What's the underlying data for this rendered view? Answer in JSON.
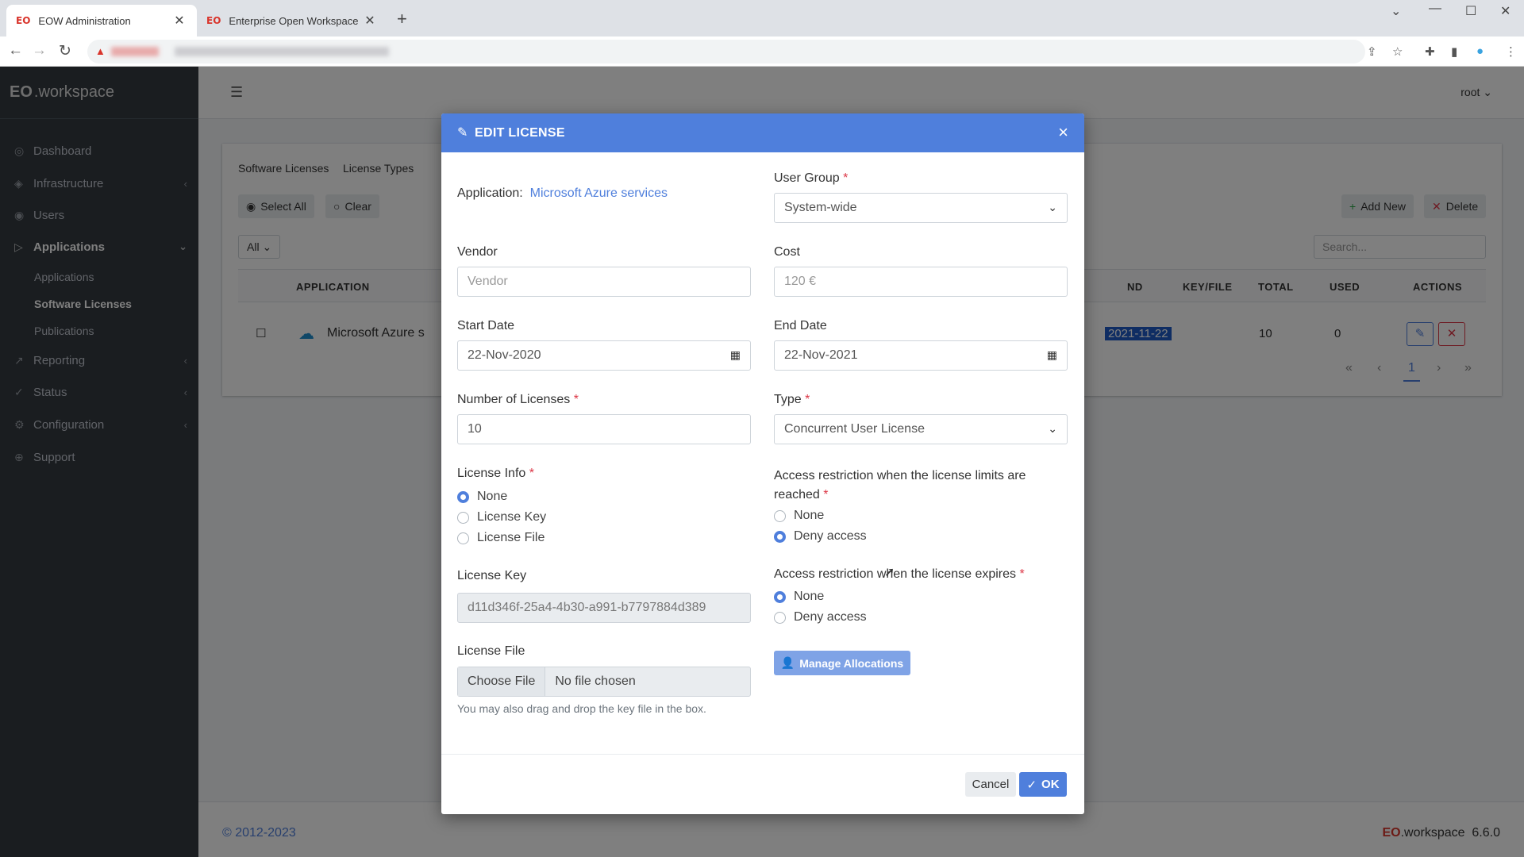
{
  "browser": {
    "tabs": [
      {
        "favicon": "EO",
        "title": "EOW Administration"
      },
      {
        "favicon": "EO",
        "title": "Enterprise Open Workspace"
      }
    ]
  },
  "app": {
    "brand_eo": "EO",
    "brand_name": ".workspace",
    "sidebar": {
      "items": [
        {
          "label": "Dashboard"
        },
        {
          "label": "Infrastructure"
        },
        {
          "label": "Users"
        },
        {
          "label": "Applications"
        },
        {
          "label": "Reporting"
        },
        {
          "label": "Status"
        },
        {
          "label": "Configuration"
        },
        {
          "label": "Support"
        }
      ],
      "subitems": [
        "Applications",
        "Software Licenses",
        "Publications"
      ]
    },
    "user": "root",
    "card": {
      "tabs": [
        "Software Licenses",
        "License Types"
      ],
      "select_all": "Select All",
      "clear": "Clear",
      "filter": "All",
      "add_new": "Add New",
      "delete": "Delete",
      "search_placeholder": "Search...",
      "columns": [
        "APPLICATION",
        "ND",
        "KEY/FILE",
        "TOTAL",
        "USED",
        "ACTIONS"
      ],
      "row": {
        "application": "Microsoft Azure s",
        "end": "2021-11-22",
        "total": "10",
        "used": "0"
      },
      "page": "1"
    },
    "footer": {
      "copyright": "© 2012-2023",
      "brand_eo": "EO",
      "brand_name": ".workspace",
      "version": "6.6.0"
    }
  },
  "modal": {
    "title": "EDIT LICENSE",
    "application_label": "Application:",
    "application_value": "Microsoft Azure services",
    "user_group": {
      "label": "User Group",
      "value": "System-wide"
    },
    "vendor": {
      "label": "Vendor",
      "placeholder": "Vendor"
    },
    "cost": {
      "label": "Cost",
      "value": "120 €"
    },
    "start_date": {
      "label": "Start Date",
      "value": "22-Nov-2020"
    },
    "end_date": {
      "label": "End Date",
      "value": "22-Nov-2021"
    },
    "num_licenses": {
      "label": "Number of Licenses",
      "value": "10"
    },
    "type": {
      "label": "Type",
      "value": "Concurrent User License"
    },
    "license_info": {
      "label": "License Info",
      "options": [
        "None",
        "License Key",
        "License File"
      ],
      "selected": "None"
    },
    "restriction_limits": {
      "label_line1": "Access restriction when the license limits are",
      "label_line2": "reached",
      "options": [
        "None",
        "Deny access"
      ],
      "selected": "Deny access"
    },
    "restriction_expires": {
      "label": "Access restriction when the license expires",
      "options": [
        "None",
        "Deny access"
      ],
      "selected": "None"
    },
    "license_key": {
      "label": "License Key",
      "value": "d11d346f-25a4-4b30-a991-b7797884d389"
    },
    "license_file": {
      "label": "License File",
      "button": "Choose File",
      "status": "No file chosen",
      "hint": "You may also drag and drop the key file in the box."
    },
    "manage_allocations": "Manage Allocations",
    "cancel": "Cancel",
    "ok": "OK",
    "required_mark": "*"
  }
}
